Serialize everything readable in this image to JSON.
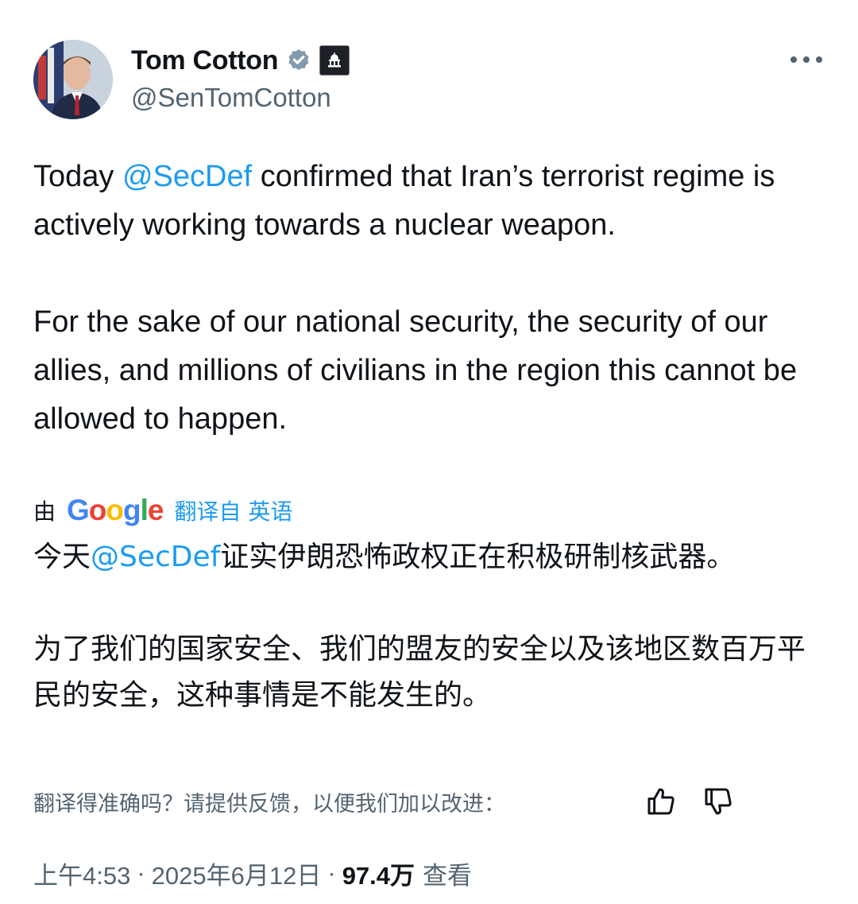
{
  "author": {
    "name": "Tom Cotton",
    "handle": "@SenTomCotton",
    "avatar_icon": "profile-photo",
    "verified_icon": "verified-badge-icon",
    "affiliation_icon": "government-building-icon"
  },
  "tweet": {
    "line1_prefix": "Today ",
    "mention": "@SecDef",
    "line1_suffix": " confirmed that Iran’s terrorist regime is actively working towards a nuclear weapon.",
    "paragraph2": "For the sake of our national security, the security of our allies, and millions of civilians in the region this cannot be allowed to happen."
  },
  "translation": {
    "by_label": "由",
    "google_letters": [
      "G",
      "o",
      "o",
      "g",
      "l",
      "e"
    ],
    "link": "翻译自 英语",
    "zh_prefix": "今天",
    "zh_mention": "@SecDef",
    "zh_rest": "证实伊朗恐怖政权正在积极研制核武器。",
    "zh_paragraph2": "为了我们的国家安全、我们的盟友的安全以及该地区数百万平民的安全，这种事情是不能发生的。",
    "feedback_prompt": "翻译得准确吗？请提供反馈，以便我们加以改进："
  },
  "meta": {
    "time": "上午4:53",
    "separator": "·",
    "date": "2025年6月12日",
    "views_count": "97.4万",
    "views_label": "查看"
  },
  "colors": {
    "link": "#1d9bf0",
    "muted": "#536471",
    "text": "#0f1419"
  }
}
